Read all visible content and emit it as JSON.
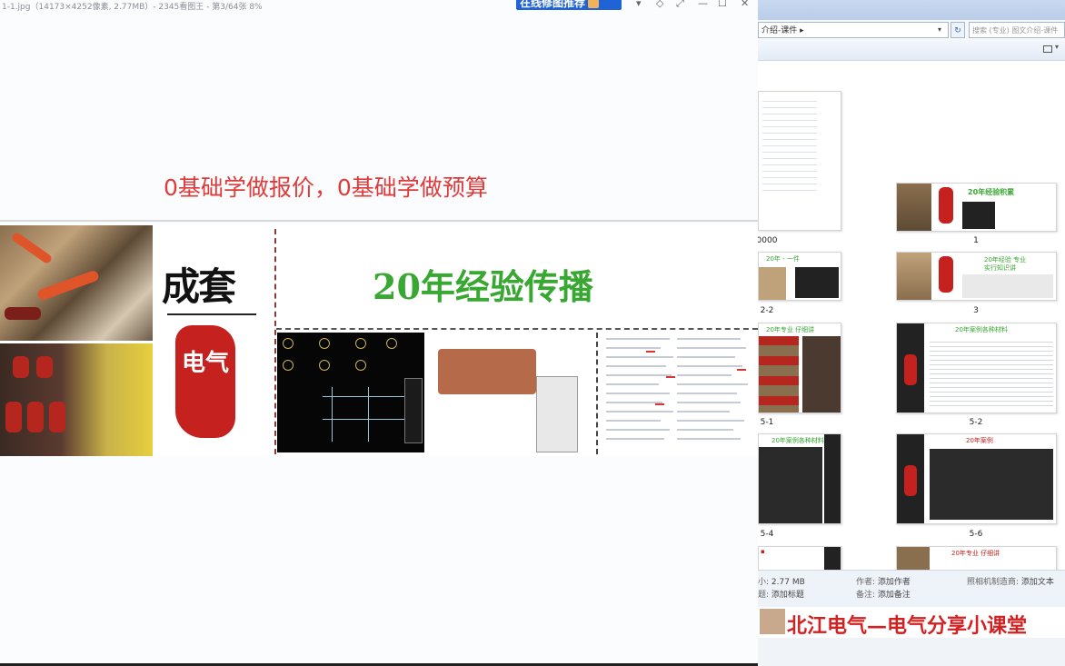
{
  "viewer": {
    "title": "1-1.jpg（14173×4252像素, 2.77MB）- 2345看图王 - 第3/64张 8%",
    "promo": "在线修图推荐",
    "controls": [
      "▾",
      "◇",
      "⤢",
      "—",
      "☐",
      "✕"
    ],
    "slide": {
      "heading": "0基础学做报价，0基础学做预算",
      "logo_text": "成套",
      "seal_text": "电气",
      "green_title": "20年经验传播"
    }
  },
  "explorer": {
    "address": "介绍-课件 ▸",
    "address_arrow": "▾",
    "refresh": "↻",
    "search_placeholder": "搜索 (专业) 图文介绍-课件",
    "thumbnails": [
      {
        "label": "0000"
      },
      {
        "label": "1"
      },
      {
        "label": "2-2"
      },
      {
        "label": "3"
      },
      {
        "label": "5-1"
      },
      {
        "label": "5-2"
      },
      {
        "label": "5-4"
      },
      {
        "label": "5-6"
      },
      {
        "label": ""
      },
      {
        "label": ""
      }
    ],
    "thumb_captions": {
      "t1": "20年经验积累",
      "t22": "20年 - 一件",
      "t3a": "20年经验 专业",
      "t3b": "实行知识讲",
      "t5": "20年专业 仔细讲",
      "t52": "20年案例各种材料",
      "t54": "20年案例各种材料",
      "t56": "20年案例",
      "t58": "20年专业 仔细讲"
    },
    "details": {
      "size_key": "小:",
      "size_val": "2.77 MB",
      "title_key": "题:",
      "title_val": "添加标题",
      "author_key": "作者:",
      "author_val": "添加作者",
      "note_key": "备注:",
      "note_val": "添加备注",
      "camera_key": "照相机制造商:",
      "camera_val": "添加文本"
    },
    "banner_text": "北江电气—电气分享小课堂"
  }
}
